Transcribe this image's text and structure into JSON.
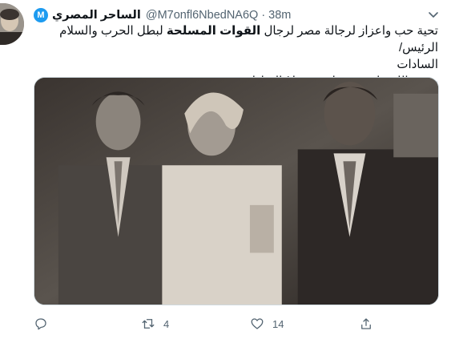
{
  "tweet": {
    "display_name": "الساحر المصري",
    "verified_badge": "M",
    "handle": "@M7onfl6NbedNA6Q",
    "separator": "·",
    "time": "38m",
    "text": {
      "line1_before": "تحية حب واعزاز لرجالة مصر لرجال ",
      "line1_bold": "القوات المسلحة",
      "line1_after": " لبطل الحرب والسلام الرئيس/",
      "line2": "السادات",
      "line3": "رحمة اللة على زعيمنا ورئيسنا / السادات"
    },
    "actions": {
      "reply_count": "",
      "retweet_count": "4",
      "like_count": "14"
    }
  },
  "icons": {
    "more": "chevron-down-icon",
    "reply": "reply-icon",
    "retweet": "retweet-icon",
    "like": "heart-icon",
    "share": "share-icon"
  },
  "colors": {
    "accent": "#1d9bf0",
    "text": "#0f1419",
    "muted": "#536471"
  }
}
